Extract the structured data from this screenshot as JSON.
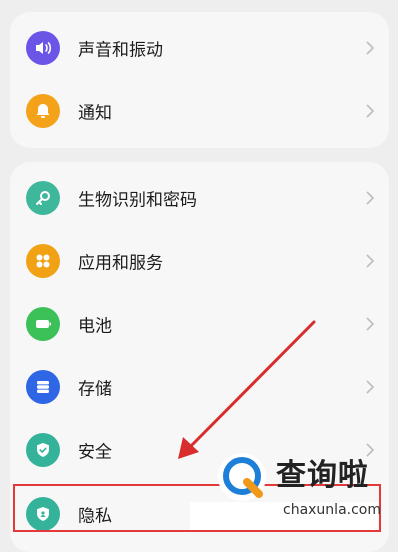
{
  "group1": [
    {
      "label": "声音和振动",
      "icon": "speaker-icon",
      "color": "#6b55e6"
    },
    {
      "label": "通知",
      "icon": "bell-icon",
      "color": "#f4a21a"
    }
  ],
  "group2": [
    {
      "label": "生物识别和密码",
      "icon": "key-icon",
      "color": "#3fb79b"
    },
    {
      "label": "应用和服务",
      "icon": "apps-grid-icon",
      "color": "#f0a114"
    },
    {
      "label": "电池",
      "icon": "battery-icon",
      "color": "#3cc159"
    },
    {
      "label": "存储",
      "icon": "storage-icon",
      "color": "#2f66e6"
    },
    {
      "label": "安全",
      "icon": "shield-check-icon",
      "color": "#35b39a"
    },
    {
      "label": "隐私",
      "icon": "shield-privacy-icon",
      "color": "#35b39a"
    }
  ],
  "watermark": {
    "brand": "查询啦",
    "site": "chaxunla.com"
  },
  "colors": {
    "highlight": "#e23a3a",
    "arrow": "#d92c2c"
  }
}
